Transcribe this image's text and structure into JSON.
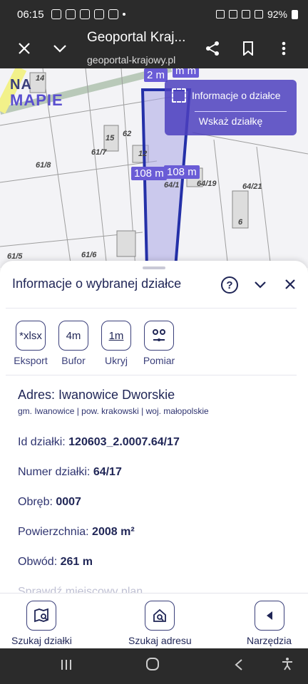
{
  "status_bar": {
    "time": "06:15",
    "battery": "92%"
  },
  "browser": {
    "title": "Geoportal Kraj...",
    "url": "geoportal-krajowy.pl"
  },
  "map": {
    "logo_top": "NA",
    "logo_bottom": "MAPIE",
    "parcel_labels": [
      "14",
      "15",
      "62",
      "12",
      "61/7",
      "61/8",
      "64/19",
      "64/21",
      "6",
      "61/5",
      "61/6",
      "64/1"
    ],
    "measures": [
      "2 m",
      "m m",
      "108 m",
      "108 m"
    ],
    "info_panel": {
      "parcel_info": "Informacje o działce",
      "show_parcel": "Wskaż działkę"
    },
    "accent": "#5a4fcf"
  },
  "sheet": {
    "heading": "Informacje o wybranej działce",
    "tools": [
      {
        "icon": "*xlsx",
        "label": "Eksport"
      },
      {
        "icon": "4m",
        "label": "Bufor"
      },
      {
        "icon": "1m",
        "label": "Ukryj"
      },
      {
        "icon": "",
        "label": "Pomiar"
      }
    ],
    "address_title": "Adres: Iwanowice Dworskie",
    "address_sub": "gm. Iwanowice | pow. krakowski | woj. małopolskie",
    "props": [
      {
        "label": "Id działki: ",
        "value": "120603_2.0007.64/17"
      },
      {
        "label": "Numer działki: ",
        "value": "64/17"
      },
      {
        "label": "Obręb: ",
        "value": "0007"
      },
      {
        "label": "Powierzchnia: ",
        "value": "2008 m²"
      },
      {
        "label": "Obwód: ",
        "value": "261 m"
      }
    ],
    "faded_row": "Sprawdź miejscowy plan"
  },
  "bottom_nav": [
    {
      "label": "Szukaj działki",
      "icon": "map-search-icon"
    },
    {
      "label": "Szukaj adresu",
      "icon": "home-search-icon"
    },
    {
      "label": "Narzędzia",
      "icon": "chevron-left-icon"
    }
  ]
}
